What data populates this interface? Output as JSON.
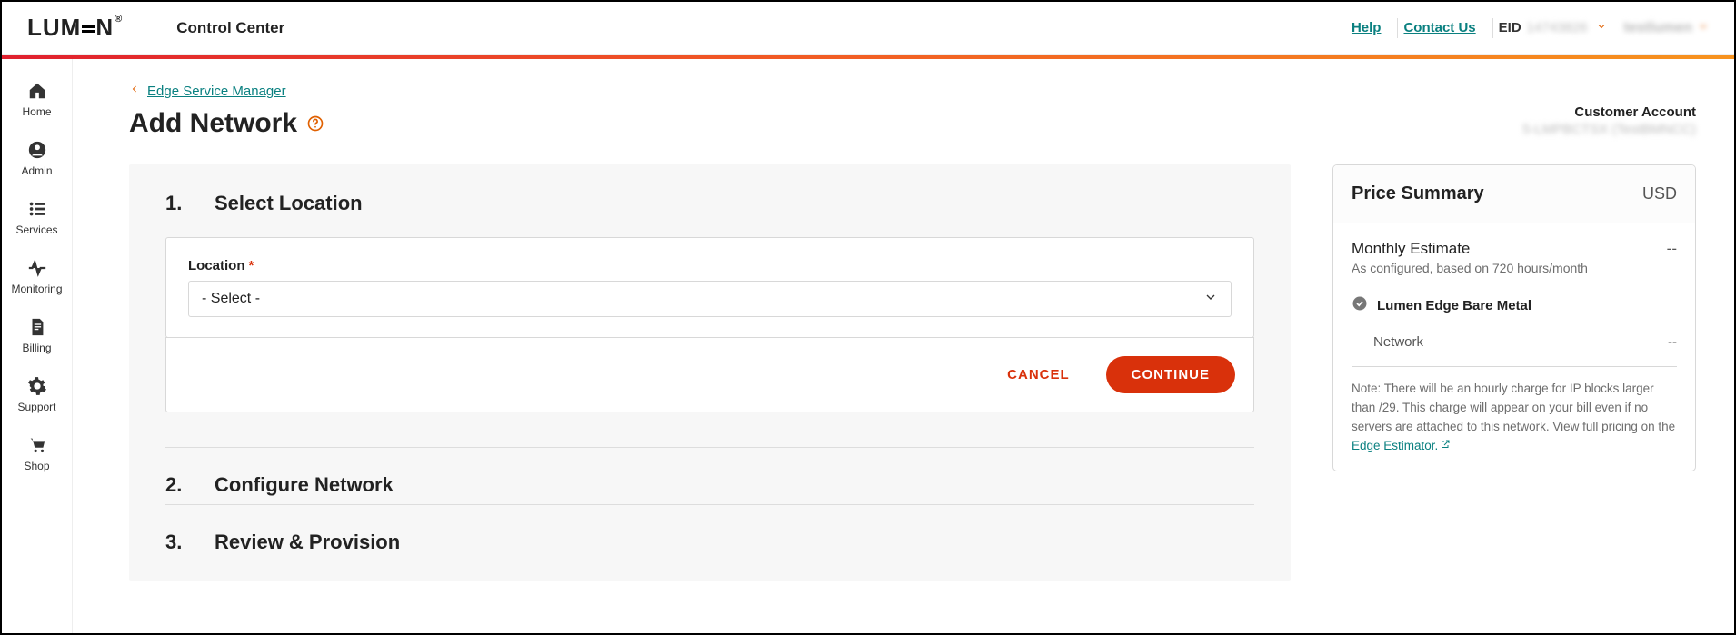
{
  "header": {
    "app_title": "Control Center",
    "help": "Help",
    "contact": "Contact Us",
    "eid_label": "EID",
    "eid_value": "14743826",
    "account_name": "testlumen"
  },
  "sidebar": {
    "items": [
      {
        "label": "Home"
      },
      {
        "label": "Admin"
      },
      {
        "label": "Services"
      },
      {
        "label": "Monitoring"
      },
      {
        "label": "Billing"
      },
      {
        "label": "Support"
      },
      {
        "label": "Shop"
      }
    ]
  },
  "breadcrumb": {
    "parent": "Edge Service Manager"
  },
  "page": {
    "title": "Add Network",
    "customer_label": "Customer Account",
    "customer_value": "5-LMPBCTSX (TestBMNCC)"
  },
  "wizard": {
    "steps": [
      {
        "num": "1.",
        "title": "Select Location"
      },
      {
        "num": "2.",
        "title": "Configure Network"
      },
      {
        "num": "3.",
        "title": "Review & Provision"
      }
    ],
    "location_label": "Location",
    "location_placeholder": "- Select -",
    "cancel": "CANCEL",
    "continue": "CONTINUE"
  },
  "price": {
    "title": "Price Summary",
    "currency": "USD",
    "monthly_label": "Monthly Estimate",
    "monthly_value": "--",
    "monthly_sub": "As configured, based on 720 hours/month",
    "service": "Lumen Edge Bare Metal",
    "network_label": "Network",
    "network_value": "--",
    "note_prefix": "Note: There will be an hourly charge for IP blocks larger than /29. This charge will appear on your bill even if no servers are attached to this network. View full pricing on the ",
    "note_link": "Edge Estimator."
  }
}
